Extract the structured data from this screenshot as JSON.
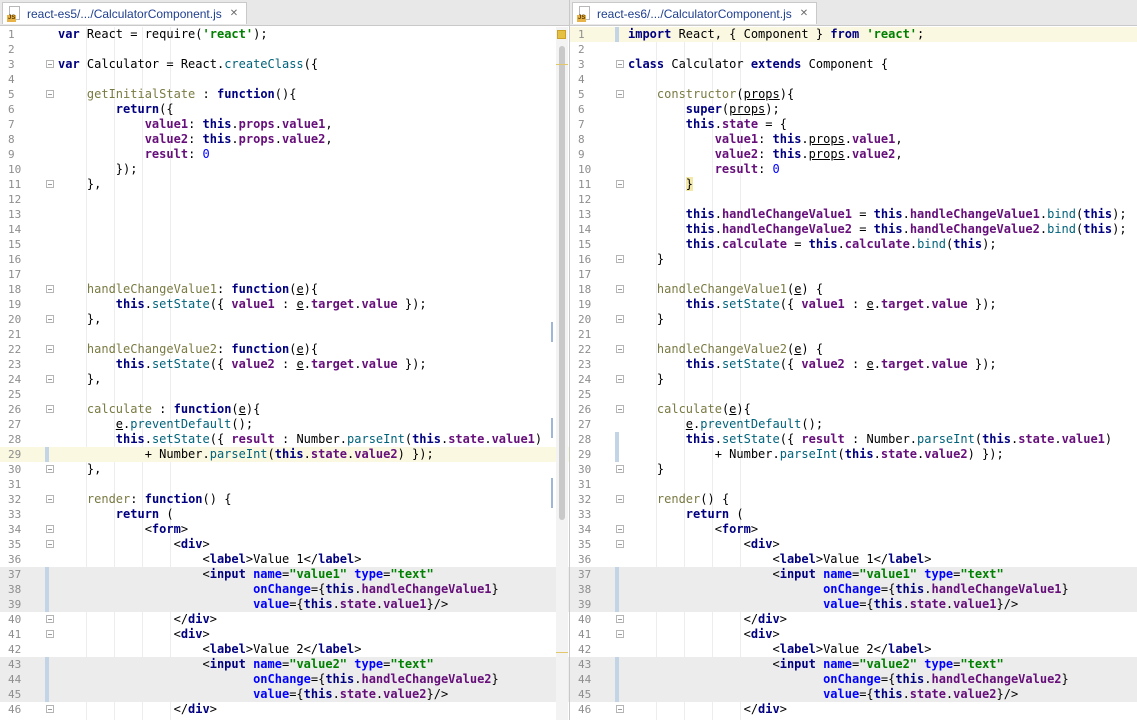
{
  "left": {
    "tab_title": "react-es5/.../CalculatorComponent.js",
    "lines": [
      "<span class=\"kw\">var</span> React = require(<span class=\"str\">'react'</span>);",
      "",
      "<span class=\"kw\">var</span> Calculator = React.<span class=\"fn\">createClass</span>({",
      "",
      "    <span class=\"meth\">getInitialState</span> : <span class=\"kw\">function</span>(){",
      "        <span class=\"kw\">return</span>({",
      "            <span class=\"prop\">value1</span>: <span class=\"kw\">this</span>.<span class=\"prop\">props</span>.<span class=\"prop\">value1</span>,",
      "            <span class=\"prop\">value2</span>: <span class=\"kw\">this</span>.<span class=\"prop\">props</span>.<span class=\"prop\">value2</span>,",
      "            <span class=\"prop\">result</span>: <span class=\"num\">0</span>",
      "        });",
      "    },",
      "",
      "",
      "",
      "",
      "",
      "",
      "    <span class=\"meth\">handleChangeValue1</span>: <span class=\"kw\">function</span>(<span class=\"ul\">e</span>){",
      "        <span class=\"kw\">this</span>.<span class=\"fn\">setState</span>({ <span class=\"prop\">value1</span> : <span class=\"ul\">e</span>.<span class=\"prop\">target</span>.<span class=\"prop\">value</span> });",
      "    },",
      "",
      "    <span class=\"meth\">handleChangeValue2</span>: <span class=\"kw\">function</span>(<span class=\"ul\">e</span>){",
      "        <span class=\"kw\">this</span>.<span class=\"fn\">setState</span>({ <span class=\"prop\">value2</span> : <span class=\"ul\">e</span>.<span class=\"prop\">target</span>.<span class=\"prop\">value</span> });",
      "    },",
      "",
      "    <span class=\"meth\">calculate</span> : <span class=\"kw\">function</span>(<span class=\"ul\">e</span>){",
      "        <span class=\"ul\">e</span>.<span class=\"fn\">preventDefault</span>();",
      "        <span class=\"kw\">this</span>.<span class=\"fn\">setState</span>({ <span class=\"prop\">result</span> : Number.<span class=\"fn\">parseInt</span>(<span class=\"kw\">this</span>.<span class=\"prop\">state</span>.<span class=\"prop\">value1</span>)",
      "            + Number.<span class=\"fn\">parseInt</span>(<span class=\"kw\">this</span>.<span class=\"prop\">state</span>.<span class=\"prop\">value2</span>) });",
      "    },",
      "",
      "    <span class=\"meth\">render</span>: <span class=\"kw\">function</span>() {",
      "        <span class=\"kw\">return</span> (",
      "            &lt;<span class=\"tag\">form</span>&gt;",
      "                &lt;<span class=\"tag\">div</span>&gt;",
      "                    &lt;<span class=\"tag\">label</span>&gt;Value 1&lt;/<span class=\"tag\">label</span>&gt;",
      "                    &lt;<span class=\"tag\">input</span> <span class=\"attr\">name</span>=<span class=\"str\">\"value1\"</span> <span class=\"attr\">type</span>=<span class=\"str\">\"text\"</span>",
      "                           <span class=\"attr\">onChange</span>={<span class=\"kw\">this</span>.<span class=\"prop\">handleChangeValue1</span>}",
      "                           <span class=\"attr\">value</span>={<span class=\"kw\">this</span>.<span class=\"prop\">state</span>.<span class=\"prop\">value1</span>}/&gt;",
      "                &lt;/<span class=\"tag\">div</span>&gt;",
      "                &lt;<span class=\"tag\">div</span>&gt;",
      "                    &lt;<span class=\"tag\">label</span>&gt;Value 2&lt;/<span class=\"tag\">label</span>&gt;",
      "                    &lt;<span class=\"tag\">input</span> <span class=\"attr\">name</span>=<span class=\"str\">\"value2\"</span> <span class=\"attr\">type</span>=<span class=\"str\">\"text\"</span>",
      "                           <span class=\"attr\">onChange</span>={<span class=\"kw\">this</span>.<span class=\"prop\">handleChangeValue2</span>}",
      "                           <span class=\"attr\">value</span>={<span class=\"kw\">this</span>.<span class=\"prop\">state</span>.<span class=\"prop\">value2</span>}/&gt;",
      "                &lt;/<span class=\"tag\">div</span>&gt;"
    ]
  },
  "right": {
    "tab_title": "react-es6/.../CalculatorComponent.js",
    "lines": [
      "<span class=\"kw\">import</span> React, { Component } <span class=\"kw\">from</span> <span class=\"str\">'react'</span>;",
      "",
      "<span class=\"kw\">class</span> Calculator <span class=\"kw\">extends</span> Component {",
      "",
      "    <span class=\"meth\">constructor</span>(<span class=\"ul\">props</span>){",
      "        <span class=\"kw\">super</span>(<span class=\"ul\">props</span>);",
      "        <span class=\"kw\">this</span>.<span class=\"prop\">state</span> = {",
      "            <span class=\"prop\">value1</span>: <span class=\"kw\">this</span>.<span class=\"ul\">props</span>.<span class=\"prop\">value1</span>,",
      "            <span class=\"prop\">value2</span>: <span class=\"kw\">this</span>.<span class=\"ul\">props</span>.<span class=\"prop\">value2</span>,",
      "            <span class=\"prop\">result</span>: <span class=\"num\">0</span>",
      "        <span class=\"brace\">}</span>",
      "",
      "        <span class=\"kw\">this</span>.<span class=\"prop\">handleChangeValue1</span> = <span class=\"kw\">this</span>.<span class=\"prop\">handleChangeValue1</span>.<span class=\"fn\">bind</span>(<span class=\"kw\">this</span>);",
      "        <span class=\"kw\">this</span>.<span class=\"prop\">handleChangeValue2</span> = <span class=\"kw\">this</span>.<span class=\"prop\">handleChangeValue2</span>.<span class=\"fn\">bind</span>(<span class=\"kw\">this</span>);",
      "        <span class=\"kw\">this</span>.<span class=\"prop\">calculate</span> = <span class=\"kw\">this</span>.<span class=\"prop\">calculate</span>.<span class=\"fn\">bind</span>(<span class=\"kw\">this</span>);",
      "    }",
      "",
      "    <span class=\"meth\">handleChangeValue1</span>(<span class=\"ul\">e</span>) {",
      "        <span class=\"kw\">this</span>.<span class=\"fn\">setState</span>({ <span class=\"prop\">value1</span> : <span class=\"ul\">e</span>.<span class=\"prop\">target</span>.<span class=\"prop\">value</span> });",
      "    }",
      "",
      "    <span class=\"meth\">handleChangeValue2</span>(<span class=\"ul\">e</span>) {",
      "        <span class=\"kw\">this</span>.<span class=\"fn\">setState</span>({ <span class=\"prop\">value2</span> : <span class=\"ul\">e</span>.<span class=\"prop\">target</span>.<span class=\"prop\">value</span> });",
      "    }",
      "",
      "    <span class=\"meth\">calculate</span>(<span class=\"ul\">e</span>){",
      "        <span class=\"ul\">e</span>.<span class=\"fn\">preventDefault</span>();",
      "        <span class=\"kw\">this</span>.<span class=\"fn\">setState</span>({ <span class=\"prop\">result</span> : Number.<span class=\"fn\">parseInt</span>(<span class=\"kw\">this</span>.<span class=\"prop\">state</span>.<span class=\"prop\">value1</span>)",
      "            + Number.<span class=\"fn\">parseInt</span>(<span class=\"kw\">this</span>.<span class=\"prop\">state</span>.<span class=\"prop\">value2</span>) });",
      "    }",
      "",
      "    <span class=\"meth\">render</span>() {",
      "        <span class=\"kw\">return</span> (",
      "            &lt;<span class=\"tag\">form</span>&gt;",
      "                &lt;<span class=\"tag\">div</span>&gt;",
      "                    &lt;<span class=\"tag\">label</span>&gt;Value 1&lt;/<span class=\"tag\">label</span>&gt;",
      "                    &lt;<span class=\"tag\">input</span> <span class=\"attr\">name</span>=<span class=\"str\">\"value1\"</span> <span class=\"attr\">type</span>=<span class=\"str\">\"text\"</span>",
      "                           <span class=\"attr\">onChange</span>={<span class=\"kw\">this</span>.<span class=\"prop\">handleChangeValue1</span>}",
      "                           <span class=\"attr\">value</span>={<span class=\"kw\">this</span>.<span class=\"prop\">state</span>.<span class=\"prop\">value1</span>}/&gt;",
      "                &lt;/<span class=\"tag\">div</span>&gt;",
      "                &lt;<span class=\"tag\">div</span>&gt;",
      "                    &lt;<span class=\"tag\">label</span>&gt;Value 2&lt;/<span class=\"tag\">label</span>&gt;",
      "                    &lt;<span class=\"tag\">input</span> <span class=\"attr\">name</span>=<span class=\"str\">\"value2\"</span> <span class=\"attr\">type</span>=<span class=\"str\">\"text\"</span>",
      "                           <span class=\"attr\">onChange</span>={<span class=\"kw\">this</span>.<span class=\"prop\">handleChangeValue2</span>}",
      "                           <span class=\"attr\">value</span>={<span class=\"kw\">this</span>.<span class=\"prop\">state</span>.<span class=\"prop\">value2</span>}/&gt;",
      "                &lt;/<span class=\"tag\">div</span>&gt;"
    ]
  }
}
